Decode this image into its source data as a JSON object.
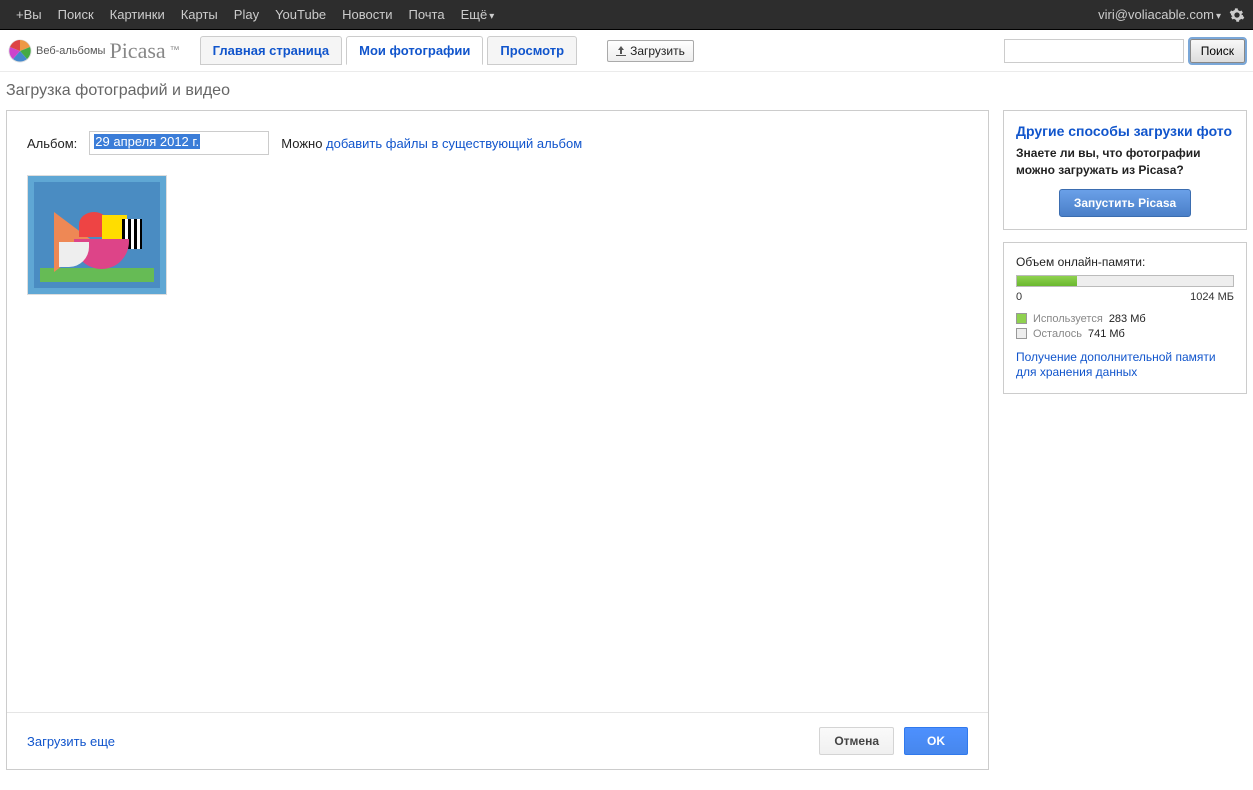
{
  "topbar": {
    "links": [
      "+Вы",
      "Поиск",
      "Картинки",
      "Карты",
      "Play",
      "YouTube",
      "Новости",
      "Почта",
      "Ещё"
    ],
    "user_email": "viri@voliacable.com"
  },
  "header": {
    "logo_small": "Веб-альбомы",
    "logo_big": "Picasa",
    "tabs": [
      {
        "label": "Главная страница",
        "active": false
      },
      {
        "label": "Мои фотографии",
        "active": true
      },
      {
        "label": "Просмотр",
        "active": false
      }
    ],
    "upload_label": "Загрузить",
    "search_button": "Поиск"
  },
  "page": {
    "title": "Загрузка фотографий и видео"
  },
  "album": {
    "label": "Альбом:",
    "value": "29 апреля 2012 г.",
    "can_text": "Можно ",
    "add_link": "добавить файлы в существующий альбом"
  },
  "footer": {
    "load_more": "Загрузить еще",
    "cancel": "Отмена",
    "ok": "OK"
  },
  "sidebar": {
    "other": {
      "title": "Другие способы загрузки фото",
      "text": "Знаете ли вы, что фотографии можно загружать из Picasa?",
      "button": "Запустить Picasa"
    },
    "storage": {
      "label": "Объем онлайн-памяти:",
      "scale_min": "0",
      "scale_max": "1024 МБ",
      "used_label": "Используется",
      "used_value": "283 Мб",
      "left_label": "Осталось",
      "left_value": "741 Мб",
      "percent": 27.6,
      "more_link": "Получение дополнительной памяти для хранения данных"
    }
  }
}
